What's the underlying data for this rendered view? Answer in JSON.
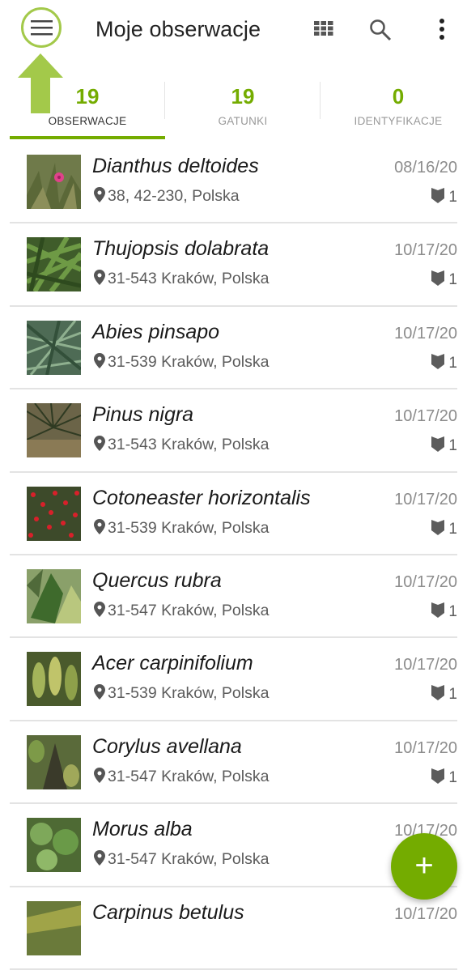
{
  "header": {
    "title": "Moje obserwacje",
    "icons": [
      "menu-icon",
      "grid-view-icon",
      "search-icon",
      "more-vert-icon"
    ]
  },
  "tabs": [
    {
      "count": "19",
      "label": "OBSERWACJE",
      "active": true
    },
    {
      "count": "19",
      "label": "GATUNKI",
      "active": false
    },
    {
      "count": "0",
      "label": "IDENTYFIKACJE",
      "active": false
    }
  ],
  "observations": [
    {
      "name": "Dianthus deltoides",
      "location": "38, 42-230, Polska",
      "date": "08/16/20",
      "identifications": "1"
    },
    {
      "name": "Thujopsis dolabrata",
      "location": "31-543 Kraków, Polska",
      "date": "10/17/20",
      "identifications": "1"
    },
    {
      "name": "Abies pinsapo",
      "location": "31-539 Kraków, Polska",
      "date": "10/17/20",
      "identifications": "1"
    },
    {
      "name": "Pinus nigra",
      "location": "31-543 Kraków, Polska",
      "date": "10/17/20",
      "identifications": "1"
    },
    {
      "name": "Cotoneaster horizontalis",
      "location": "31-539 Kraków, Polska",
      "date": "10/17/20",
      "identifications": "1"
    },
    {
      "name": "Quercus rubra",
      "location": "31-547 Kraków, Polska",
      "date": "10/17/20",
      "identifications": "1"
    },
    {
      "name": "Acer carpinifolium",
      "location": "31-539 Kraków, Polska",
      "date": "10/17/20",
      "identifications": "1"
    },
    {
      "name": "Corylus avellana",
      "location": "31-547 Kraków, Polska",
      "date": "10/17/20",
      "identifications": "1"
    },
    {
      "name": "Morus alba",
      "location": "31-547 Kraków, Polska",
      "date": "10/17/20",
      "identifications": ""
    },
    {
      "name": "Carpinus betulus",
      "location": "",
      "date": "10/17/20",
      "identifications": ""
    }
  ],
  "fab": {
    "label": "+"
  },
  "colors": {
    "accent": "#74ac00",
    "annotation": "#a3c94a"
  }
}
